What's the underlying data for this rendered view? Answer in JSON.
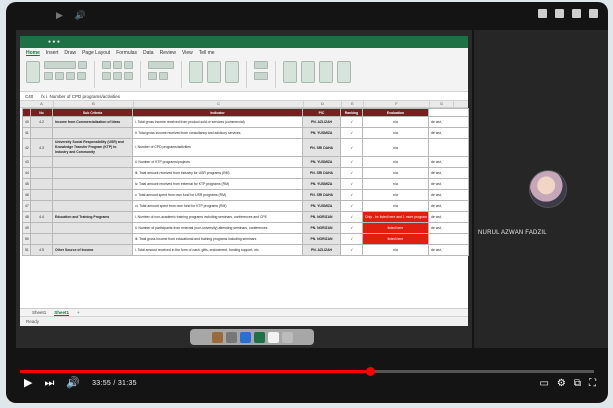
{
  "video_controls": {
    "play_icon": "▶",
    "next_icon": "⏭",
    "volume_icon": "🔊",
    "time": "33:55 / 31:35",
    "progress_fraction": 0.61,
    "right_icons": [
      "▭",
      "⚙",
      "⧉",
      "⛶"
    ]
  },
  "participant": {
    "name": "NURUL AZWAN FADZIL"
  },
  "excel": {
    "menu": [
      "Home",
      "Insert",
      "Draw",
      "Page Layout",
      "Formulas",
      "Data",
      "Review",
      "View",
      "Tell me"
    ],
    "formula_ref": "C40",
    "formula": "fx  i. Number of CPD programs/activities",
    "sheet_tabs": [
      "Sheet1",
      "Sheet1",
      "+"
    ],
    "status": "Ready",
    "column_heads": [
      "A",
      "B",
      "C",
      "D",
      "E",
      "F",
      "G"
    ],
    "table_head": [
      "No",
      "Sub Criteria",
      "Indicator",
      "PIC",
      "Ranking",
      "Evaluation",
      ""
    ],
    "rows": [
      {
        "num": "40",
        "no": "4.2",
        "criteria": "Income from Commercialization of Ideas",
        "indicator": "i. Total gross income received from product sold or services (commercial)",
        "pic": "PN. AZLIZAH",
        "rank": "√",
        "eval": "n/a",
        "note": "de wst,",
        "red": false
      },
      {
        "num": "41",
        "no": "",
        "criteria": "",
        "indicator": "ii. Total gross income received from consultancy and advisory services",
        "pic": "PN. YUSMIZA",
        "rank": "√",
        "eval": "n/a",
        "note": "de wst,",
        "red": false
      },
      {
        "num": "42",
        "no": "4.3",
        "criteria": "University Social Responsibility (USR) and Knowledge Transfer Program (KTP) to Industry and Community",
        "indicator": "i. Number of CPD programs/activities",
        "pic": "PN. SRI DAHA",
        "rank": "√",
        "eval": "n/a",
        "note": "",
        "red": false
      },
      {
        "num": "43",
        "no": "",
        "criteria": "",
        "indicator": "ii. Number of KTP programs/projects",
        "pic": "PN. YUSMIZA",
        "rank": "√",
        "eval": "n/a",
        "note": "de wst,",
        "red": false
      },
      {
        "num": "44",
        "no": "",
        "criteria": "",
        "indicator": "iii. Total amount received from industry for USR programs (RM)",
        "pic": "PN. SRI DAHA",
        "rank": "√",
        "eval": "n/a",
        "note": "de wst,",
        "red": false
      },
      {
        "num": "45",
        "no": "",
        "criteria": "",
        "indicator": "iv. Total amount received from external for KTP programs (RM)",
        "pic": "PN. YUSMIZA",
        "rank": "√",
        "eval": "n/a",
        "note": "de wst,",
        "red": false
      },
      {
        "num": "46",
        "no": "",
        "criteria": "",
        "indicator": "v. Total amount spent from own fund for USR programs (RM)",
        "pic": "PN. SRI DAHA",
        "rank": "√",
        "eval": "n/a",
        "note": "de wst,",
        "red": false
      },
      {
        "num": "47",
        "no": "",
        "criteria": "",
        "indicator": "vi. Total amount spent from own fund for KTP programs (RM)",
        "pic": "PN. YUSMIZA",
        "rank": "√",
        "eval": "n/a",
        "note": "de wst,",
        "red": false
      },
      {
        "num": "48",
        "no": "4.4",
        "criteria": "Education and Training Programs",
        "indicator": "i. Number of non-academic training programs including seminars, conferences and CPE",
        "pic": "PN. NORIZAN",
        "rank": "√",
        "eval": "Only - be listed here and 1 more program",
        "note": "de wst,",
        "red": true
      },
      {
        "num": "49",
        "no": "",
        "criteria": "",
        "indicator": "ii. Number of participants from external (non-university) attending seminars, conferences",
        "pic": "PN. NORIZAN",
        "rank": "√",
        "eval": "listed here",
        "note": "de wst,",
        "red": true
      },
      {
        "num": "50",
        "no": "",
        "criteria": "",
        "indicator": "iii. Total gross income from educational and training programs including seminars",
        "pic": "PN. NORIZAN",
        "rank": "√",
        "eval": "listed here",
        "note": "",
        "red": true
      },
      {
        "num": "51",
        "no": "4.5",
        "criteria": "Other Source of Income",
        "indicator": "i. Total amount received in the form of cash, gifts, endowment, funding support, etc",
        "pic": "PN. AZLIZAH",
        "rank": "√",
        "eval": "n/a",
        "note": "de wst,",
        "red": false
      }
    ]
  },
  "colors": {
    "excel_green": "#1e7145",
    "header_maroon": "#7a1f1f",
    "flag_red": "#e11f10",
    "progress_red": "#ff0000"
  }
}
